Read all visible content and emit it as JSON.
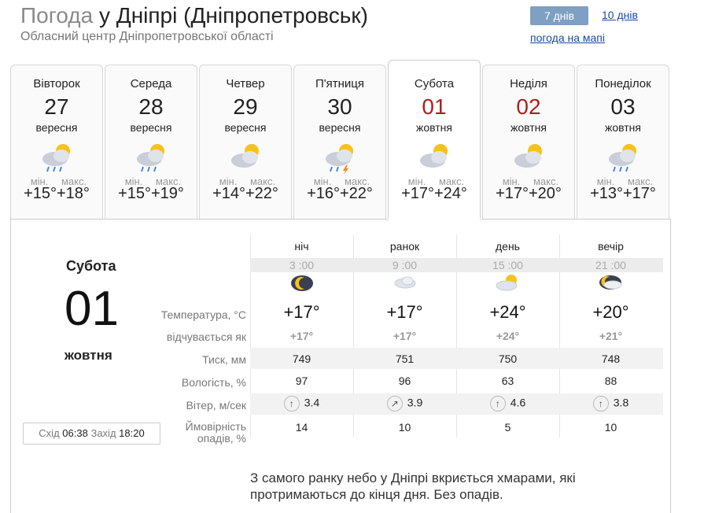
{
  "header": {
    "title_prefix": "Погода",
    "title_place": "у Дніпрі (Дніпропетровськ)",
    "subtitle": "Обласний центр Дніпропетровської області"
  },
  "nav": {
    "days7": "7 днів",
    "days10": "10 днів",
    "map": "погода на мапі"
  },
  "days": [
    {
      "name": "Вівторок",
      "num": "27",
      "month": "вересня",
      "min_label": "мін.",
      "max_label": "макс.",
      "min": "+15°",
      "max": "+18°",
      "icon": "cloud-sun-rain-icon",
      "weekend": false
    },
    {
      "name": "Середа",
      "num": "28",
      "month": "вересня",
      "min_label": "мін.",
      "max_label": "макс.",
      "min": "+15°",
      "max": "+19°",
      "icon": "cloud-sun-rain-icon",
      "weekend": false
    },
    {
      "name": "Четвер",
      "num": "29",
      "month": "вересня",
      "min_label": "мін.",
      "max_label": "макс.",
      "min": "+14°",
      "max": "+22°",
      "icon": "cloud-sun-icon",
      "weekend": false
    },
    {
      "name": "П'ятниця",
      "num": "30",
      "month": "вересня",
      "min_label": "мін.",
      "max_label": "макс.",
      "min": "+16°",
      "max": "+22°",
      "icon": "cloud-sun-thunder-icon",
      "weekend": false
    },
    {
      "name": "Субота",
      "num": "01",
      "month": "жовтня",
      "min_label": "мін.",
      "max_label": "макс.",
      "min": "+17°",
      "max": "+24°",
      "icon": "cloud-sun-icon",
      "weekend": true
    },
    {
      "name": "Неділя",
      "num": "02",
      "month": "жовтня",
      "min_label": "мін.",
      "max_label": "макс.",
      "min": "+17°",
      "max": "+20°",
      "icon": "cloud-sun-icon",
      "weekend": true
    },
    {
      "name": "Понеділок",
      "num": "03",
      "month": "жовтня",
      "min_label": "мін.",
      "max_label": "макс.",
      "min": "+13°",
      "max": "+17°",
      "icon": "cloud-sun-rain-icon",
      "weekend": false
    }
  ],
  "selected": {
    "day_name": "Субота",
    "day_num": "01",
    "month": "жовтня",
    "sunrise_label": "Схід",
    "sunrise": "06:38",
    "sunset_label": "Захід",
    "sunset": "18:20"
  },
  "table": {
    "periods": [
      {
        "name": "ніч",
        "time": "3 :00",
        "temp": "+17°",
        "feels": "+17°",
        "pressure": "749",
        "humidity": "97",
        "wind_dir": "↑",
        "wind": "3.4",
        "precip": "14",
        "icon": "moon-icon"
      },
      {
        "name": "ранок",
        "time": "9 :00",
        "temp": "+17°",
        "feels": "+17°",
        "pressure": "751",
        "humidity": "96",
        "wind_dir": "↗",
        "wind": "3.9",
        "precip": "10",
        "icon": "cloud-icon"
      },
      {
        "name": "день",
        "time": "15 :00",
        "temp": "+24°",
        "feels": "+24°",
        "pressure": "750",
        "humidity": "63",
        "wind_dir": "↑",
        "wind": "4.6",
        "precip": "5",
        "icon": "cloud-sun-icon"
      },
      {
        "name": "вечір",
        "time": "21 :00",
        "temp": "+20°",
        "feels": "+21°",
        "pressure": "748",
        "humidity": "88",
        "wind_dir": "↑",
        "wind": "3.8",
        "precip": "10",
        "icon": "cloud-moon-icon"
      }
    ],
    "labels": {
      "temperature": "Температура, °C",
      "feels": "відчувається як",
      "pressure": "Тиск, мм",
      "humidity": "Вологість, %",
      "wind": "Вітер, м/сек",
      "precip_line1": "Ймовірність",
      "precip_line2": "опадів, %"
    }
  },
  "description": "З самого ранку небо у Дніпрі вкриється хмарами, які протримаються до кінця дня. Без опадів.",
  "colors": {
    "accent_blue": "#7f9fc3",
    "link": "#1a4a9a",
    "weekend_red": "#b01e1e",
    "sun": "#f7c21b",
    "cloud": "#c9ced8"
  }
}
